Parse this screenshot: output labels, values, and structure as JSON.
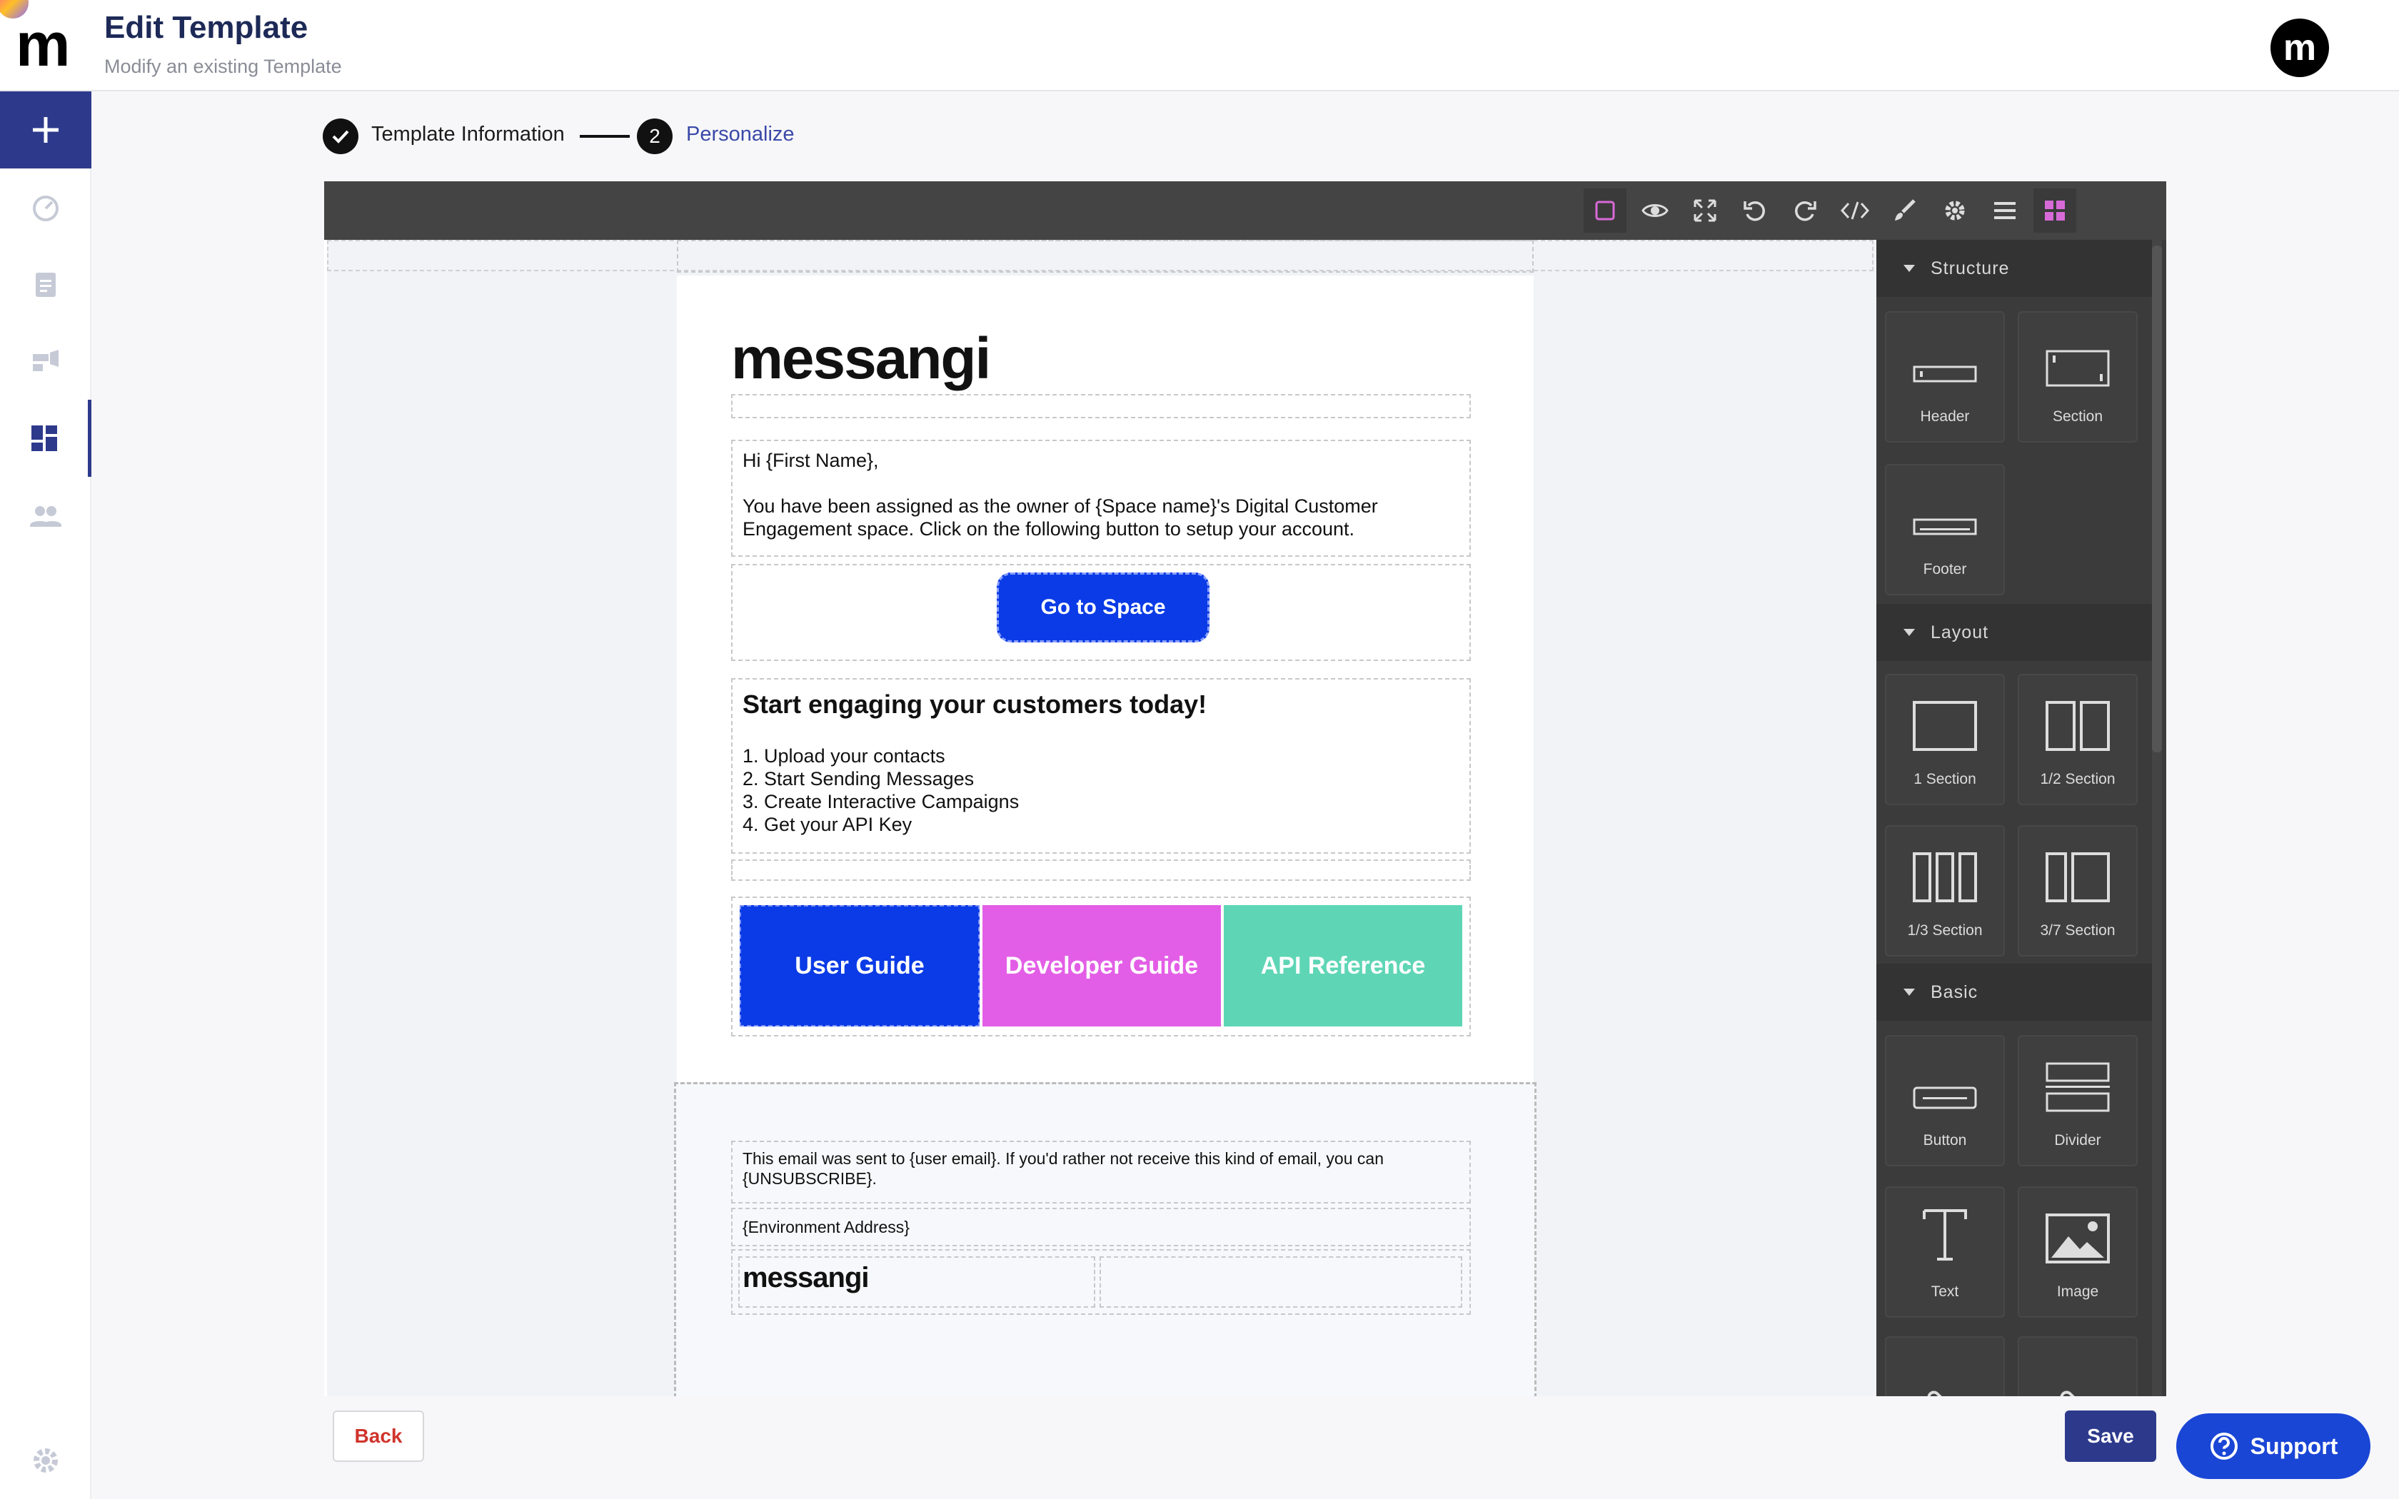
{
  "header": {
    "title": "Edit Template",
    "subtitle": "Modify an existing Template",
    "avatar_letter": "m",
    "logo_letter": "m"
  },
  "sidebar": {
    "items": [
      {
        "name": "add",
        "icon": "plus-icon",
        "active": false
      },
      {
        "name": "dashboard",
        "icon": "gauge-icon",
        "active": false
      },
      {
        "name": "reports",
        "icon": "clipboard-icon",
        "active": false
      },
      {
        "name": "campaigns",
        "icon": "megaphone-icon",
        "active": false
      },
      {
        "name": "templates",
        "icon": "grid-icon",
        "active": true
      },
      {
        "name": "contacts",
        "icon": "people-icon",
        "active": false
      },
      {
        "name": "settings",
        "icon": "gear-icon",
        "active": false
      }
    ]
  },
  "stepper": {
    "step1_label": "Template Information",
    "step2_number": "2",
    "step2_label": "Personalize"
  },
  "toolbar": {
    "buttons": [
      "square-outline-icon",
      "eye-icon",
      "fullscreen-icon",
      "undo-icon",
      "redo-icon",
      "code-icon",
      "brush-icon",
      "gear-icon",
      "menu-icon",
      "blocks-icon"
    ]
  },
  "email": {
    "brand": "messangi",
    "greeting": "Hi {First Name},",
    "body_line1": "You have been assigned as the owner of {Space name}'s Digital Customer",
    "body_line2": "Engagement space. Click on the following button to setup your account.",
    "cta": "Go to Space",
    "heading": "Start engaging your customers today!",
    "list": [
      "1. Upload your contacts",
      "2. Start Sending Messages",
      "3. Create Interactive Campaigns",
      "4. Get your API Key"
    ],
    "tiles": [
      {
        "label": "User Guide",
        "color": "#0a3be6"
      },
      {
        "label": "Developer Guide",
        "color": "#e35ee6"
      },
      {
        "label": "API Reference",
        "color": "#5ed6b5"
      }
    ],
    "footer_line1": "This email was sent to {user email}. If you'd rather not receive this kind of email, you can",
    "footer_line2": "{UNSUBSCRIBE}.",
    "footer_address": "{Environment Address}",
    "footer_brand": "messangi"
  },
  "panel": {
    "structure_label": "Structure",
    "layout_label": "Layout",
    "basic_label": "Basic",
    "structure_blocks": [
      "Header",
      "Section",
      "Footer"
    ],
    "layout_blocks": [
      "1 Section",
      "1/2 Section",
      "1/3 Section",
      "3/7 Section"
    ],
    "basic_blocks": [
      "Button",
      "Divider",
      "Text",
      "Image"
    ]
  },
  "actions": {
    "back": "Back",
    "save": "Save",
    "support": "Support"
  },
  "colors": {
    "brand_navy": "#2d3a8c",
    "cta_blue": "#0a3be6",
    "support_blue": "#1a46d6",
    "back_red": "#d0342c"
  }
}
